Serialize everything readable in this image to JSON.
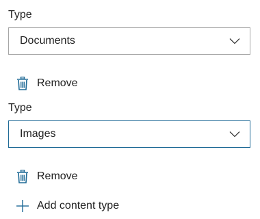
{
  "content_types": [
    {
      "label": "Type",
      "selected": "Documents",
      "focused": false,
      "remove_label": "Remove"
    },
    {
      "label": "Type",
      "selected": "Images",
      "focused": true,
      "remove_label": "Remove"
    }
  ],
  "add_label": "Add content type",
  "colors": {
    "accent": "#1f6a96",
    "icon": "#1f6a96",
    "text": "#1f1f1f",
    "border": "#a6a6a6"
  },
  "icons": {
    "remove": "trash-icon",
    "add": "plus-icon",
    "dropdown": "chevron-down-icon"
  }
}
